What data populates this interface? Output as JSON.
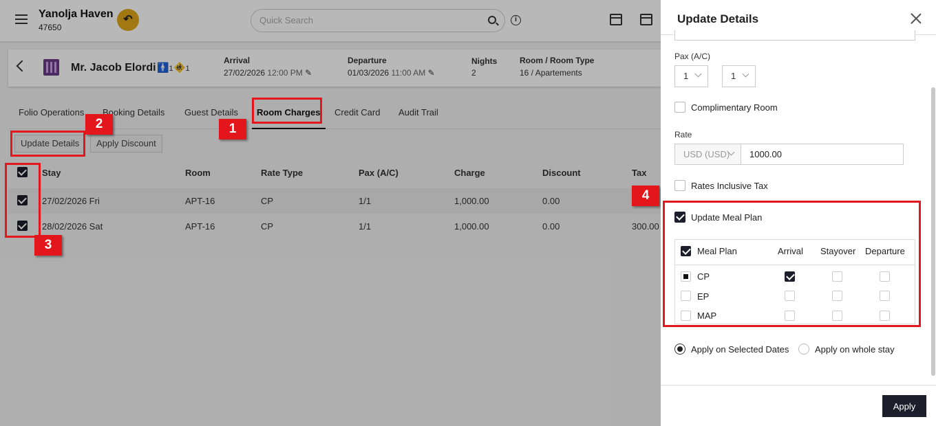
{
  "topbar": {
    "hotel_name": "Yanolja Haven",
    "hotel_id": "47650",
    "search_placeholder": "Quick Search"
  },
  "guest": {
    "name": "Mr. Jacob Elordi",
    "adults": "1",
    "children": "1",
    "arrival_label": "Arrival",
    "arrival_date": "27/02/2026",
    "arrival_time": "12:00 PM",
    "departure_label": "Departure",
    "departure_date": "01/03/2026",
    "departure_time": "11:00 AM",
    "nights_label": "Nights",
    "nights": "2",
    "room_label": "Room / Room Type",
    "room": "16 / Apartements"
  },
  "tabs": [
    "Folio Operations",
    "Booking Details",
    "Guest Details",
    "Room Charges",
    "Credit Card",
    "Audit Trail"
  ],
  "actions": {
    "update_details": "Update Details",
    "apply_discount": "Apply Discount"
  },
  "table": {
    "headers": [
      "Stay",
      "Room",
      "Rate Type",
      "Pax (A/C)",
      "Charge",
      "Discount",
      "Tax"
    ],
    "rows": [
      {
        "stay": "27/02/2026 Fri",
        "room": "APT-16",
        "rate_type": "CP",
        "pax": "1/1",
        "charge": "1,000.00",
        "discount": "0.00",
        "tax": ""
      },
      {
        "stay": "28/02/2026 Sat",
        "room": "APT-16",
        "rate_type": "CP",
        "pax": "1/1",
        "charge": "1,000.00",
        "discount": "0.00",
        "tax": "300.00"
      }
    ]
  },
  "annotations": [
    "1",
    "2",
    "3",
    "4"
  ],
  "panel": {
    "title": "Update Details",
    "pax_label": "Pax (A/C)",
    "pax_adults": "1",
    "pax_children": "1",
    "complimentary": "Complimentary Room",
    "rate_label": "Rate",
    "currency": "USD (USD)",
    "rate_value": "1000.00",
    "rates_inclusive": "Rates Inclusive Tax",
    "update_meal": "Update Meal Plan",
    "meal_headers": [
      "Meal Plan",
      "Arrival",
      "Stayover",
      "Departure"
    ],
    "meal_rows": [
      "CP",
      "EP",
      "MAP"
    ],
    "apply_selected": "Apply on Selected Dates",
    "apply_whole": "Apply on whole stay",
    "apply_button": "Apply"
  },
  "colors": {
    "accent": "#1d1d2b",
    "highlight": "#e3161b",
    "back_button": "#e0a71a"
  }
}
